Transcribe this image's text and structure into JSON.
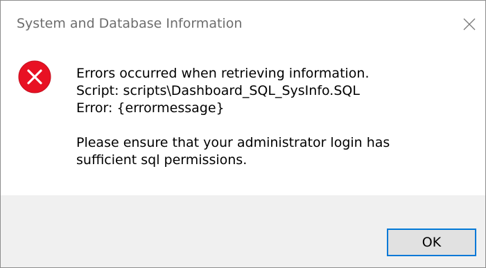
{
  "dialog": {
    "title": "System and Database Information",
    "icon": "error-icon",
    "message_lines": [
      "Errors occurred when retrieving information.",
      "Script: scripts\\Dashboard_SQL_SysInfo.SQL",
      "Error: {errormessage}",
      "",
      "Please ensure that your administrator login has",
      "sufficient sql permissions."
    ],
    "ok_label": "OK"
  },
  "colors": {
    "error_red": "#e81123",
    "button_border": "#0078d7",
    "footer_bg": "#f0f0f0",
    "title_text": "#6d6d6d"
  }
}
